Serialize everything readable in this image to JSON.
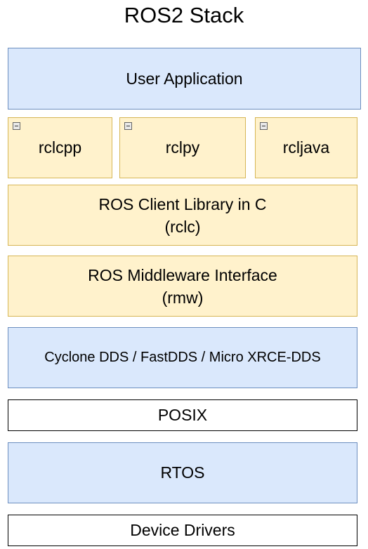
{
  "title": "ROS2 Stack",
  "colors": {
    "blue_fill": "#dae8fc",
    "blue_border": "#6c8ebf",
    "yellow_fill": "#fff2cc",
    "yellow_border": "#d6b656",
    "white_fill": "#ffffff",
    "black_border": "#000000"
  },
  "layers": {
    "user_application": "User Application",
    "rclcpp": "rclcpp",
    "rclpy": "rclpy",
    "rcljava": "rcljava",
    "rclc": "ROS Client Library in C\n(rclc)",
    "rmw": "ROS Middleware Interface\n(rmw)",
    "dds": "Cyclone DDS / FastDDS / Micro XRCE-DDS",
    "posix": "POSIX",
    "rtos": "RTOS",
    "device_drivers": "Device Drivers"
  },
  "icons": {
    "collapse": "collapse-icon"
  }
}
